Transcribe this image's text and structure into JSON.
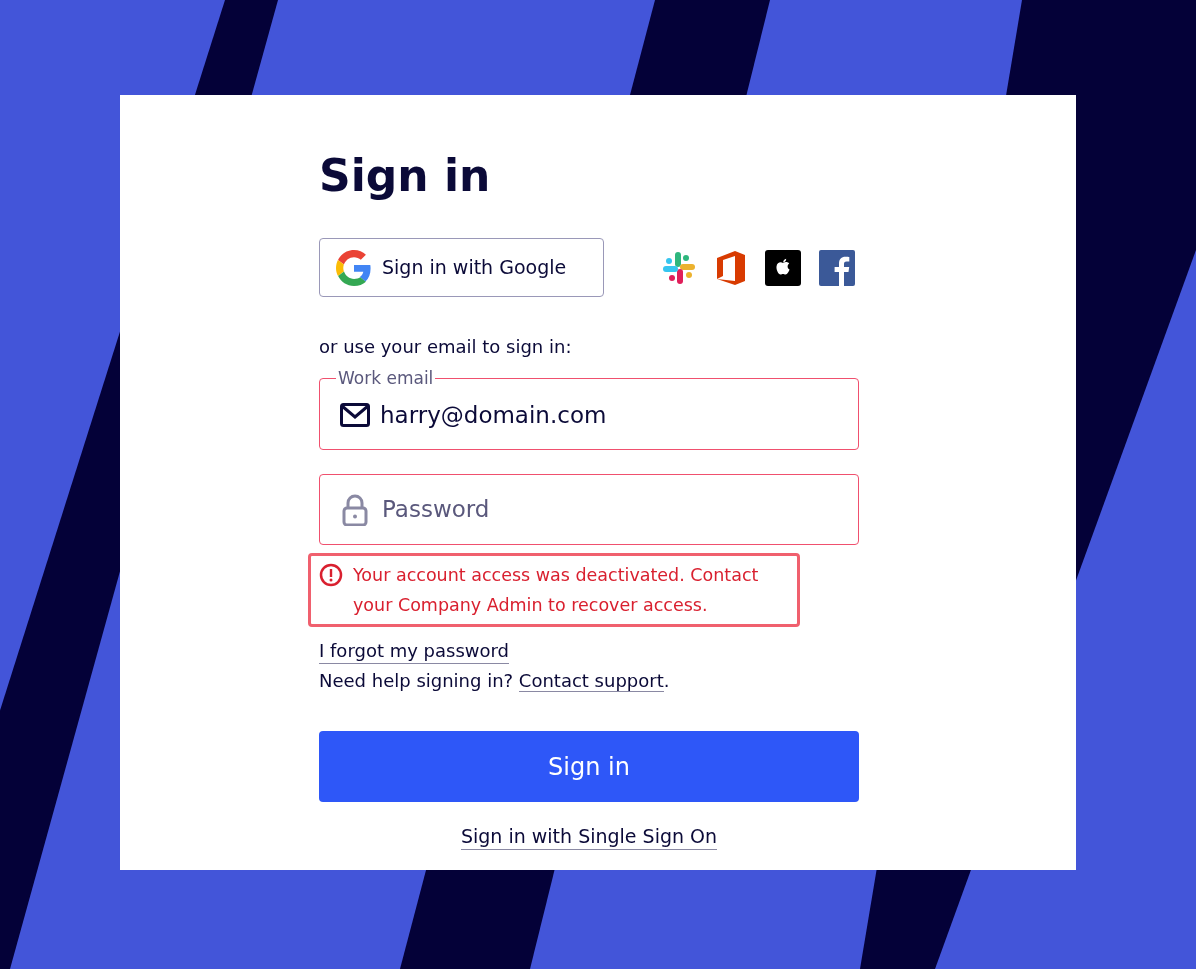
{
  "title": "Sign in",
  "google_button": {
    "label": "Sign in with Google"
  },
  "social_providers": [
    {
      "kind": "slack"
    },
    {
      "kind": "office"
    },
    {
      "kind": "apple"
    },
    {
      "kind": "facebook"
    }
  ],
  "email_prompt": "or use your email to sign in:",
  "email_field": {
    "label": "Work email",
    "value": "harry@domain.com",
    "invalid": true
  },
  "password_field": {
    "placeholder": "Password",
    "invalid": true
  },
  "error": {
    "message": "Your account access was deactivated. Contact your Company Admin to recover access."
  },
  "forgot_link": "I forgot my password",
  "help": {
    "text": "Need help signing in?",
    "link": "Contact support",
    "suffix": "."
  },
  "submit_button": "Sign in",
  "sso_link": "Sign in with Single Sign On"
}
